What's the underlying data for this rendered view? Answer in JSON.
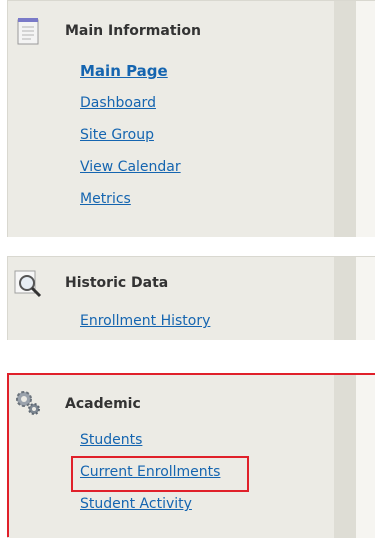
{
  "colors": {
    "link": "#1565b0",
    "highlight": "#e0202a",
    "panel_bg": "#ecebe5"
  },
  "main_information": {
    "heading": "Main Information",
    "icon": "notepad-icon",
    "links": [
      "Main Page",
      "Dashboard",
      "Site Group",
      "View Calendar",
      "Metrics"
    ],
    "active": "Main Page"
  },
  "historic_data": {
    "heading": "Historic Data",
    "icon": "magnifier-icon",
    "links": [
      "Enrollment History"
    ]
  },
  "academic": {
    "heading": "Academic",
    "icon": "gears-icon",
    "links": [
      "Students",
      "Current Enrollments",
      "Student Activity"
    ],
    "highlighted": "Current Enrollments"
  }
}
